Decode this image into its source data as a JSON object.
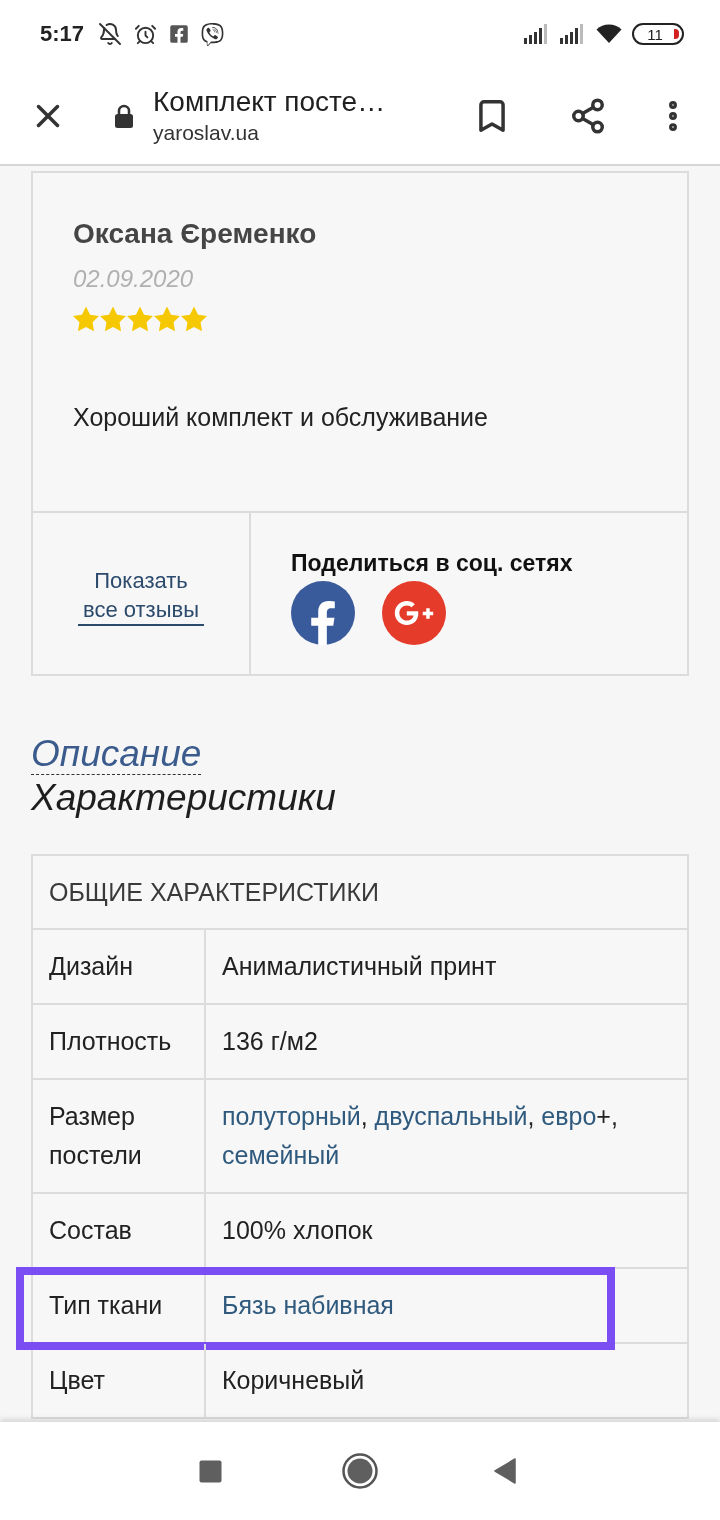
{
  "status_bar": {
    "time": "5:17",
    "battery": "11"
  },
  "toolbar": {
    "title": "Комплект посте…",
    "url": "yaroslav.ua"
  },
  "review": {
    "author": "Оксана Єременко",
    "date": "02.09.2020",
    "stars": 5,
    "text": "Хороший комплект и обслуживание",
    "show_all_link": "Показать все отзывы",
    "share_title": "Поделиться в соц. сетях",
    "share_networks": [
      {
        "kind": "facebook"
      },
      {
        "kind": "googleplus"
      }
    ]
  },
  "tabs": [
    {
      "label": "Описание",
      "selected": false
    },
    {
      "label": "Характеристики",
      "selected": true
    }
  ],
  "specs_table": {
    "title": "ОБЩИЕ ХАРАКТЕРИСТИКИ",
    "rows": [
      {
        "label": "Дизайн",
        "value": [
          {
            "text": "Анималистичный принт",
            "link": false
          }
        ],
        "highlighted": false
      },
      {
        "label": "Плотность",
        "value": [
          {
            "text": "136 г/м2",
            "link": false
          }
        ],
        "highlighted": false
      },
      {
        "label": "Размер постели",
        "value": [
          {
            "text": "полуторный",
            "link": true
          },
          {
            "text": ", ",
            "link": false
          },
          {
            "text": "двуспальный",
            "link": true
          },
          {
            "text": ", ",
            "link": false
          },
          {
            "text": "евро",
            "link": true
          },
          {
            "text": "+, ",
            "link": false
          },
          {
            "text": "семейный",
            "link": true
          }
        ],
        "highlighted": false
      },
      {
        "label": "Состав",
        "value": [
          {
            "text": "100% хлопок",
            "link": false
          }
        ],
        "highlighted": false
      },
      {
        "label": "Тип ткани",
        "value": [
          {
            "text": "Бязь набивная",
            "link": true
          }
        ],
        "highlighted": true
      },
      {
        "label": "Цвет",
        "value": [
          {
            "text": "Коричневый",
            "link": false
          }
        ],
        "highlighted": false
      }
    ]
  }
}
